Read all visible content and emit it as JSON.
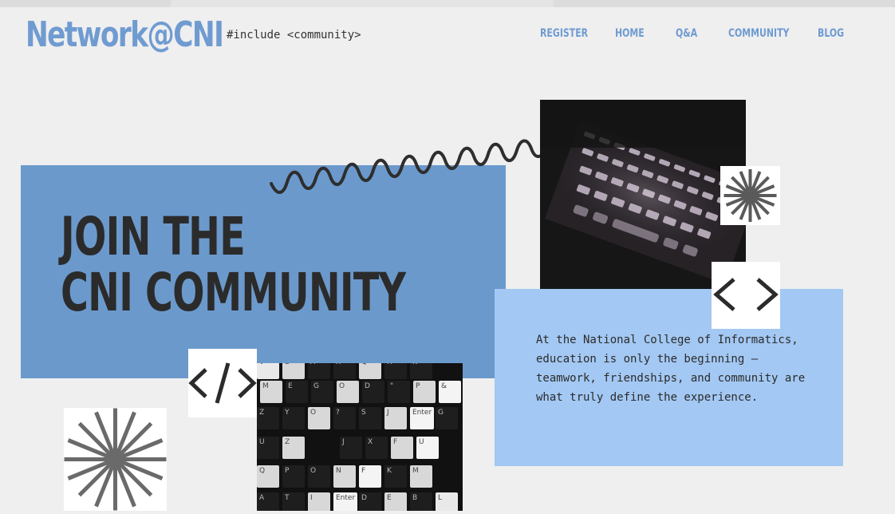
{
  "header": {
    "brand": "Network@CNI",
    "tagline": "#include <community>",
    "nav": [
      {
        "label": "REGISTER"
      },
      {
        "label": "HOME"
      },
      {
        "label": "Q&A"
      },
      {
        "label": "COMMUNITY"
      },
      {
        "label": "BLOG"
      }
    ]
  },
  "hero": {
    "title_line1": "JOIN THE",
    "title_line2": "CNI COMMUNITY"
  },
  "info": {
    "text": "At the National College of Informatics, education is only the beginning — teamwork, friendships, and community are what truly define the experience."
  },
  "keycaps": {
    "row1": [
      "V",
      "B",
      "A",
      "X",
      "Q",
      "H",
      "K"
    ],
    "row2": [
      "M",
      "E",
      "G",
      "O",
      "D",
      "\"",
      "P",
      "&"
    ],
    "row3": [
      "Z",
      "Y",
      "O",
      "?",
      "S",
      "J",
      "Enter",
      "G"
    ],
    "row4": [
      "U",
      "Z",
      "J",
      "X",
      "F",
      "U"
    ],
    "row5": [
      "Q",
      "P",
      "O",
      "N",
      "F",
      "K",
      "M"
    ],
    "row6": [
      "A",
      "T",
      "I",
      "Enter",
      "D",
      "E",
      "B",
      "L"
    ]
  },
  "colors": {
    "brand_blue": "#6f9bd1",
    "hero_blue": "#6b99cc",
    "light_blue": "#a3c8f3",
    "background": "#efefef",
    "text_dark": "#2b2b2b"
  },
  "icons": {
    "star_top": "asterisk-star-icon",
    "chevrons": "chevrons-icon",
    "code": "code-tag-icon",
    "star_bottom": "asterisk-star-icon"
  }
}
